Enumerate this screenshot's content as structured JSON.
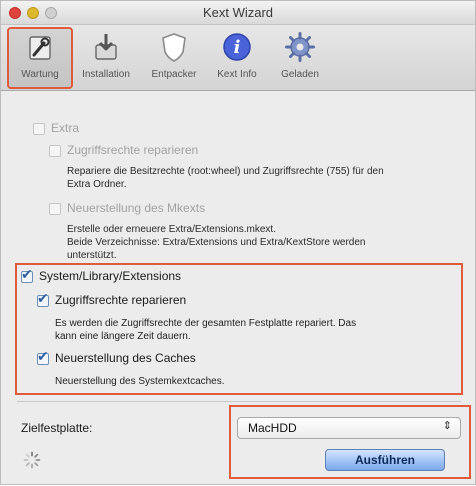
{
  "window": {
    "title": "Kext Wizard"
  },
  "toolbar": {
    "items": [
      {
        "label": "Wartung",
        "icon": "wrench-doc-icon",
        "selected": true
      },
      {
        "label": "Installation",
        "icon": "installer-icon",
        "selected": false
      },
      {
        "label": "Entpacker",
        "icon": "shield-icon",
        "selected": false
      },
      {
        "label": "Kext Info",
        "icon": "info-icon",
        "selected": false
      },
      {
        "label": "Geladen",
        "icon": "gear-icon",
        "selected": false
      }
    ]
  },
  "options": {
    "extra": {
      "label": "Extra",
      "checked": false,
      "enabled": false,
      "repair_label": "Zugriffsrechte reparieren",
      "repair_desc_1": "Repariere die Besitzrechte (root:wheel) und Zugriffsrechte (755) für den",
      "repair_desc_2": "Extra Ordner.",
      "rebuild_label": "Neuerstellung des Mkexts",
      "rebuild_desc_1": "Erstelle oder erneuere Extra/Extensions.mkext.",
      "rebuild_desc_2": "Beide Verzeichnisse: Extra/Extensions und Extra/KextStore werden",
      "rebuild_desc_3": "unterstützt."
    },
    "system": {
      "label": "System/Library/Extensions",
      "checked": true,
      "repair_label": "Zugriffsrechte reparieren",
      "repair_checked": true,
      "repair_desc_1": "Es werden die Zugriffsrechte der gesamten Festplatte repariert. Das",
      "repair_desc_2": "kann eine längere Zeit dauern.",
      "rebuild_label": "Neuerstellung des Caches",
      "rebuild_checked": true,
      "rebuild_desc": "Neuerstellung des Systemkextcaches."
    }
  },
  "footer": {
    "target_label": "Zielfestplatte:",
    "target_value": "MacHDD",
    "select_arrows": "⇕",
    "run_label": "Ausführen"
  },
  "colors": {
    "highlight_outline": "#e05a3b",
    "checkbox_accent": "#2f5fa0",
    "primary_button": "#7aa7ec"
  }
}
